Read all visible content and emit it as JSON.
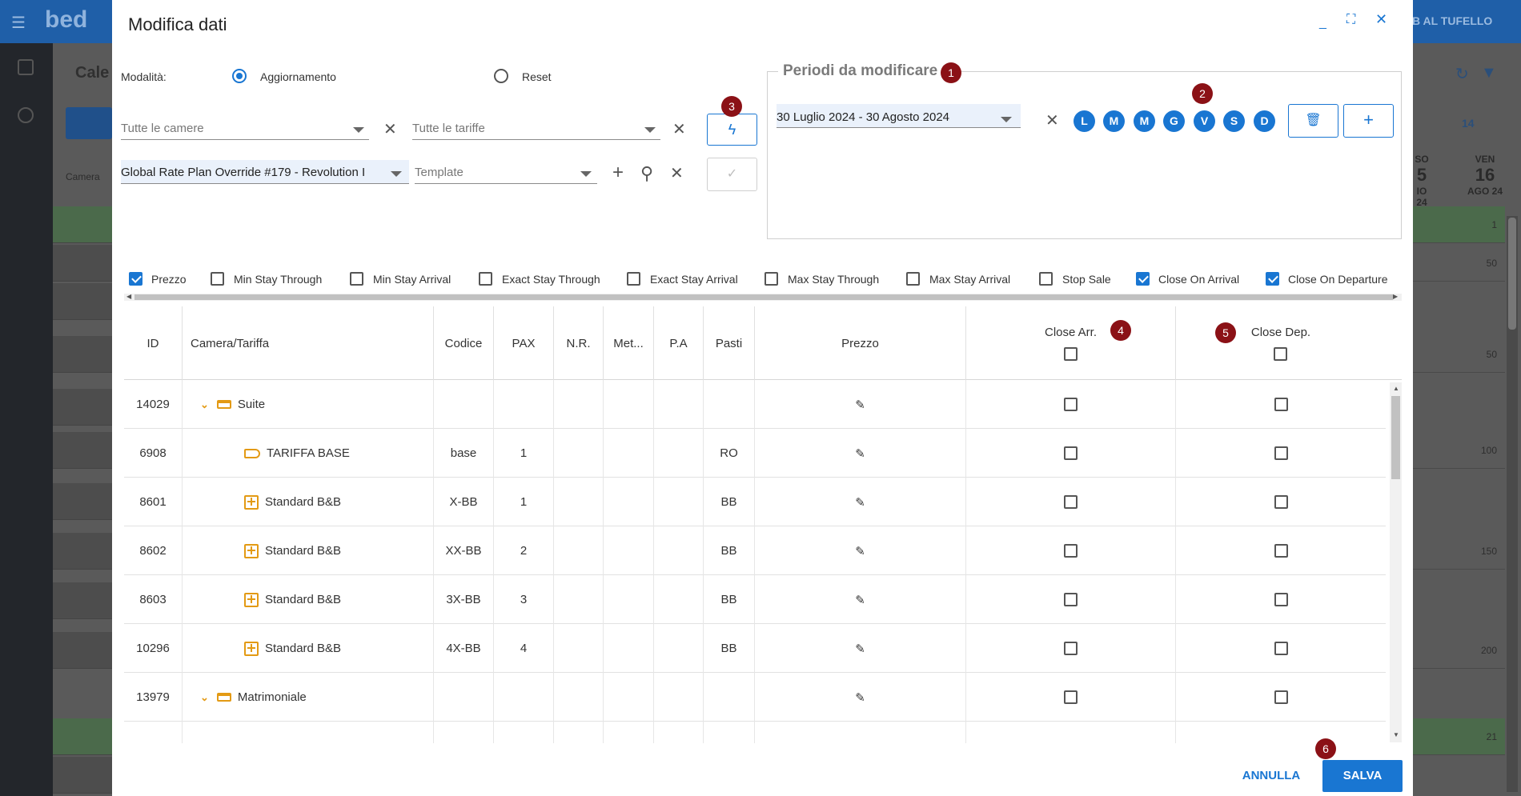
{
  "background": {
    "logo": "bed",
    "topright_text": "B AL TUFELLO",
    "page_title": "Cale",
    "col_label": "Camera",
    "days": [
      {
        "name": "SO",
        "num": "5",
        "sub": "IO 24"
      },
      {
        "name": "VEN",
        "num": "16",
        "sub": "AGO 24"
      }
    ],
    "right_cells": [
      "1",
      "50",
      "50",
      "100",
      "150",
      "200",
      "21"
    ],
    "page_badge": "14"
  },
  "dialog": {
    "title": "Modifica dati",
    "mode_label": "Modalità:",
    "mode_options": [
      "Aggiornamento",
      "Reset"
    ],
    "mode_selected": "Aggiornamento",
    "rooms_placeholder": "Tutte le camere",
    "rates_placeholder": "Tutte le tariffe",
    "rate_plan_value": "Global Rate Plan Override #179 - Revolution I",
    "template_placeholder": "Template",
    "periods_legend": "Periodi da modificare",
    "period_value": "30 Luglio 2024 - 30 Agosto 2024",
    "weekdays": [
      "L",
      "M",
      "M",
      "G",
      "V",
      "S",
      "D"
    ],
    "badges": [
      "1",
      "2",
      "3",
      "4",
      "5",
      "6"
    ],
    "fields": [
      {
        "label": "Prezzo",
        "checked": true
      },
      {
        "label": "Min Stay Through",
        "checked": false
      },
      {
        "label": "Min Stay Arrival",
        "checked": false
      },
      {
        "label": "Exact Stay Through",
        "checked": false
      },
      {
        "label": "Exact Stay Arrival",
        "checked": false
      },
      {
        "label": "Max Stay Through",
        "checked": false
      },
      {
        "label": "Max Stay Arrival",
        "checked": false
      },
      {
        "label": "Stop Sale",
        "checked": false
      },
      {
        "label": "Close On Arrival",
        "checked": true
      },
      {
        "label": "Close On Departure",
        "checked": true
      }
    ],
    "columns": [
      "ID",
      "Camera/Tariffa",
      "Codice",
      "PAX",
      "N.R.",
      "Met...",
      "P.A",
      "Pasti",
      "Prezzo",
      "Close Arr.",
      "Close Dep."
    ],
    "rows": [
      {
        "id": "14029",
        "name": "Suite",
        "type": "room",
        "code": "",
        "pax": "",
        "meals": ""
      },
      {
        "id": "6908",
        "name": "TARIFFA BASE",
        "type": "tag",
        "code": "base",
        "pax": "1",
        "meals": "RO"
      },
      {
        "id": "8601",
        "name": "Standard B&B",
        "type": "rate",
        "code": "X-BB",
        "pax": "1",
        "meals": "BB"
      },
      {
        "id": "8602",
        "name": "Standard B&B",
        "type": "rate",
        "code": "XX-BB",
        "pax": "2",
        "meals": "BB"
      },
      {
        "id": "8603",
        "name": "Standard B&B",
        "type": "rate",
        "code": "3X-BB",
        "pax": "3",
        "meals": "BB"
      },
      {
        "id": "10296",
        "name": "Standard B&B",
        "type": "rate",
        "code": "4X-BB",
        "pax": "4",
        "meals": "BB"
      },
      {
        "id": "13979",
        "name": "Matrimoniale",
        "type": "room",
        "code": "",
        "pax": "",
        "meals": ""
      }
    ],
    "cancel_label": "ANNULLA",
    "save_label": "SALVA",
    "colors": {
      "accent": "#1976d2",
      "badge": "#8b1116",
      "icon": "#e39a14"
    }
  }
}
